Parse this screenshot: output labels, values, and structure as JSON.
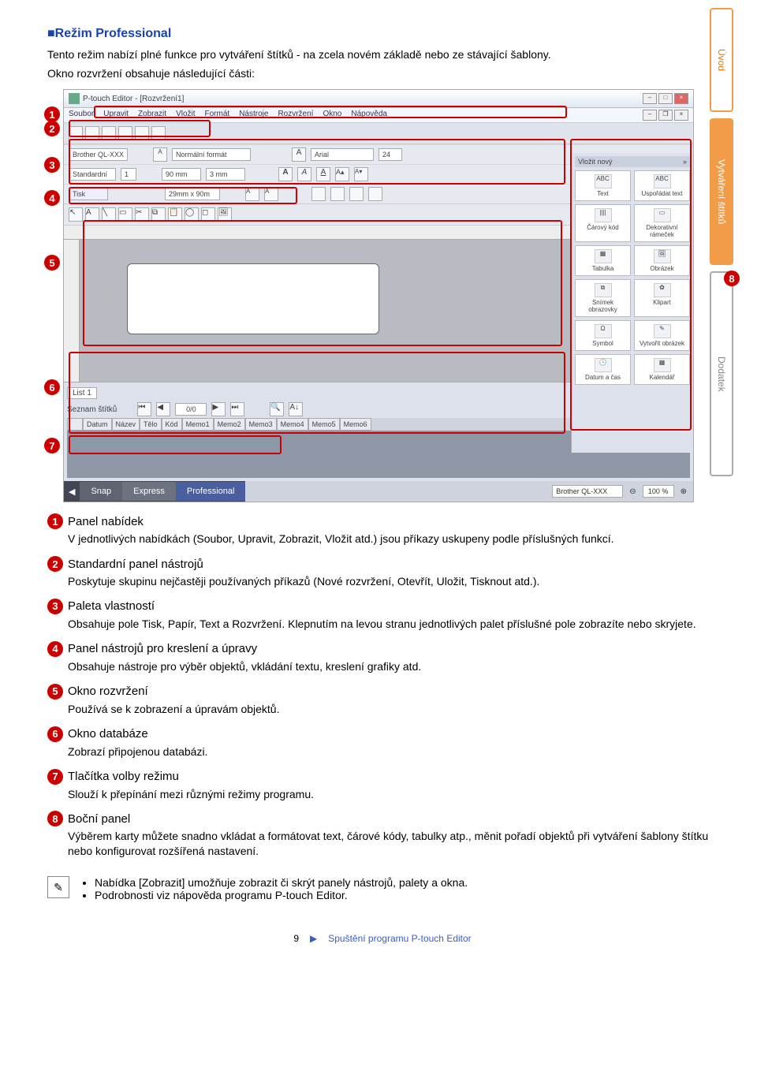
{
  "side_tabs": {
    "t1": "Úvod",
    "t2": "Vytváření štítků",
    "t3": "Dodatek"
  },
  "section_title": "■Režim Professional",
  "intro1": "Tento režim nabízí plné funkce pro vytváření štítků - na zcela novém základě nebo ze stávající šablony.",
  "intro2": "Okno rozvržení obsahuje následující části:",
  "callouts": {
    "c1": "1",
    "c2": "2",
    "c3": "3",
    "c4": "4",
    "c5": "5",
    "c6": "6",
    "c7": "7",
    "c8": "8"
  },
  "screenshot": {
    "title": "P-touch Editor - [Rozvržení1]",
    "menu": [
      "Soubor",
      "Upravit",
      "Zobrazit",
      "Vložit",
      "Formát",
      "Nástroje",
      "Rozvržení",
      "Okno",
      "Nápověda"
    ],
    "props": {
      "printer": "Brother QL-XXX",
      "format": "Normální formát",
      "font": "Arial",
      "fontsize": "24",
      "paper": "Standardní",
      "qty": "1",
      "width": "90 mm",
      "height": "3 mm",
      "print": "Tisk",
      "size_label": "29mm x 90m",
      "mode_name": "Professional"
    },
    "canvas_size": "29mm x 90mm",
    "sidepanel": {
      "hdr": "Vložit nový",
      "items": [
        "Text",
        "Uspořádat text",
        "Čárový kód",
        "Dekorativní rámeček",
        "Tabulka",
        "Obrázek",
        "Snímek obrazovky",
        "Klipart",
        "Symbol",
        "Vytvořit obrázek",
        "Datum a čas",
        "Kalendář"
      ]
    },
    "list": {
      "tab": "List 1",
      "label": "Seznam štítků",
      "pager": "0/0",
      "cols": [
        "Datum",
        "Název",
        "Tělo",
        "Kód",
        "Memo1",
        "Memo2",
        "Memo3",
        "Memo4",
        "Memo5",
        "Memo6"
      ]
    },
    "modebar": {
      "snap": "Snap",
      "express": "Express",
      "prof": "Professional",
      "printer": "Brother QL-XXX",
      "zoom": "100 %"
    }
  },
  "descriptions": [
    {
      "n": "1",
      "title": "Panel nabídek",
      "body": "V jednotlivých nabídkách (Soubor, Upravit, Zobrazit, Vložit atd.) jsou příkazy uskupeny podle příslušných funkcí."
    },
    {
      "n": "2",
      "title": "Standardní panel nástrojů",
      "body": "Poskytuje skupinu nejčastěji používaných příkazů (Nové rozvržení, Otevřít, Uložit, Tisknout atd.)."
    },
    {
      "n": "3",
      "title": "Paleta vlastností",
      "body": "Obsahuje pole Tisk, Papír, Text a Rozvržení. Klepnutím na levou stranu jednotlivých palet příslušné pole zobrazíte nebo skryjete."
    },
    {
      "n": "4",
      "title": "Panel nástrojů pro kreslení a úpravy",
      "body": "Obsahuje nástroje pro výběr objektů, vkládání textu, kreslení grafiky atd."
    },
    {
      "n": "5",
      "title": "Okno rozvržení",
      "body": "Používá se k zobrazení a úpravám objektů."
    },
    {
      "n": "6",
      "title": "Okno databáze",
      "body": "Zobrazí připojenou databázi."
    },
    {
      "n": "7",
      "title": "Tlačítka volby režimu",
      "body": "Slouží k přepínání mezi různými režimy programu."
    },
    {
      "n": "8",
      "title": "Boční panel",
      "body": "Výběrem karty můžete snadno vkládat a formátovat text, čárové kódy, tabulky atp., měnit pořadí objektů při vytváření šablony štítku nebo konfigurovat rozšířená nastavení."
    }
  ],
  "notes": [
    "Nabídka [Zobrazit] umožňuje zobrazit či skrýt panely nástrojů, palety a okna.",
    "Podrobnosti viz nápověda programu P-touch Editor."
  ],
  "footer": {
    "page": "9",
    "link": "Spuštění programu P-touch Editor"
  }
}
